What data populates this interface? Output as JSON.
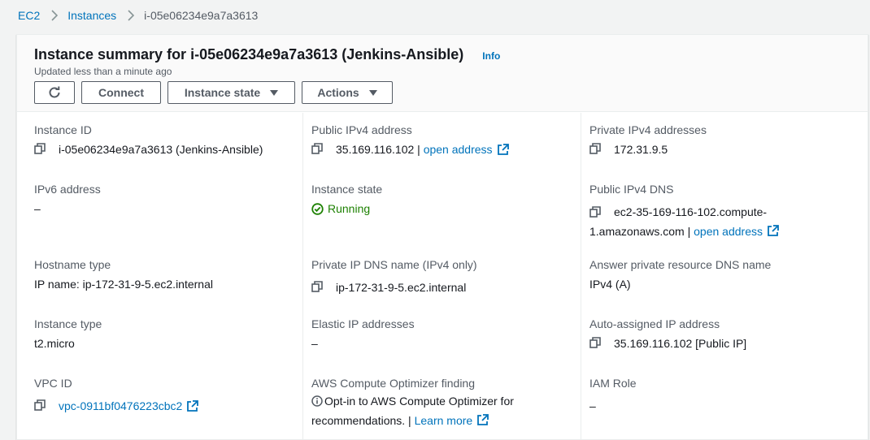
{
  "breadcrumb": {
    "root": "EC2",
    "section": "Instances",
    "current": "i-05e06234e9a7a3613"
  },
  "header": {
    "title": "Instance summary for i-05e06234e9a7a3613 (Jenkins-Ansible)",
    "info_label": "Info",
    "subtitle": "Updated less than a minute ago",
    "buttons": {
      "connect": "Connect",
      "instance_state": "Instance state",
      "actions": "Actions"
    }
  },
  "fields": {
    "instance_id": {
      "label": "Instance ID",
      "value": "i-05e06234e9a7a3613 (Jenkins-Ansible)"
    },
    "public_ipv4": {
      "label": "Public IPv4 address",
      "value": "35.169.116.102 | ",
      "link": "open address"
    },
    "private_ipv4": {
      "label": "Private IPv4 addresses",
      "value": "172.31.9.5"
    },
    "ipv6": {
      "label": "IPv6 address",
      "value": "–"
    },
    "instance_state": {
      "label": "Instance state",
      "value": "Running"
    },
    "public_dns": {
      "label": "Public IPv4 DNS",
      "value_line1": "ec2-35-169-116-102.compute-",
      "value_line2": "1.amazonaws.com | ",
      "link": "open address"
    },
    "hostname_type": {
      "label": "Hostname type",
      "value": "IP name: ip-172-31-9-5.ec2.internal"
    },
    "private_dns": {
      "label": "Private IP DNS name (IPv4 only)",
      "value": "ip-172-31-9-5.ec2.internal"
    },
    "answer_dns": {
      "label": "Answer private resource DNS name",
      "value": "IPv4 (A)"
    },
    "instance_type": {
      "label": "Instance type",
      "value": "t2.micro"
    },
    "elastic_ip": {
      "label": "Elastic IP addresses",
      "value": "–"
    },
    "auto_ip": {
      "label": "Auto-assigned IP address",
      "value": "35.169.116.102 [Public IP]"
    },
    "vpc_id": {
      "label": "VPC ID",
      "value": "vpc-0911bf0476223cbc2"
    },
    "optimizer": {
      "label": "AWS Compute Optimizer finding",
      "value": "Opt-in to AWS Compute Optimizer for recommendations. | ",
      "link": "Learn more"
    },
    "iam_role": {
      "label": "IAM Role",
      "value": "–"
    }
  },
  "colors": {
    "link": "#0073bb",
    "running": "#1d8102",
    "label": "#545b64",
    "text": "#16191f"
  }
}
